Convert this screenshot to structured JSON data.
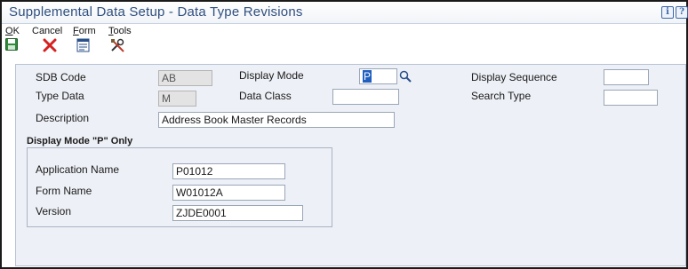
{
  "window": {
    "title": "Supplemental Data Setup - Data Type Revisions",
    "icons": [
      "info-icon",
      "help-icon"
    ]
  },
  "toolbar": {
    "ok": {
      "label": "OK",
      "underline": "O",
      "rest": "K",
      "icon": "save-disk-icon"
    },
    "cancel": {
      "label": "Cancel",
      "underline": "",
      "rest": "Cancel",
      "icon": "red-x-icon"
    },
    "form": {
      "label": "Form",
      "underline": "F",
      "rest": "orm",
      "icon": "form-icon"
    },
    "tools": {
      "label": "Tools",
      "underline": "T",
      "rest": "ools",
      "icon": "tools-icon"
    }
  },
  "form": {
    "sdb_code": {
      "label": "SDB Code",
      "value": "AB"
    },
    "type_data": {
      "label": "Type Data",
      "value": "M"
    },
    "description": {
      "label": "Description",
      "value": "Address Book Master Records"
    },
    "display_mode": {
      "label": "Display Mode",
      "value": "P"
    },
    "data_class": {
      "label": "Data Class",
      "value": ""
    },
    "display_sequence": {
      "label": "Display Sequence",
      "value": ""
    },
    "search_type": {
      "label": "Search Type",
      "value": ""
    }
  },
  "display_mode_p": {
    "title": "Display Mode \"P\" Only",
    "application_name": {
      "label": "Application Name",
      "value": "P01012"
    },
    "form_name": {
      "label": "Form Name",
      "value": "W01012A"
    },
    "version": {
      "label": "Version",
      "value": "ZJDE0001"
    }
  },
  "colors": {
    "title_text": "#2f4f7f",
    "panel_bg": "#edf0f6",
    "selection": "#1f5fbf",
    "cancel_x": "#d42020",
    "ok_disk": "#2f8a3a"
  }
}
